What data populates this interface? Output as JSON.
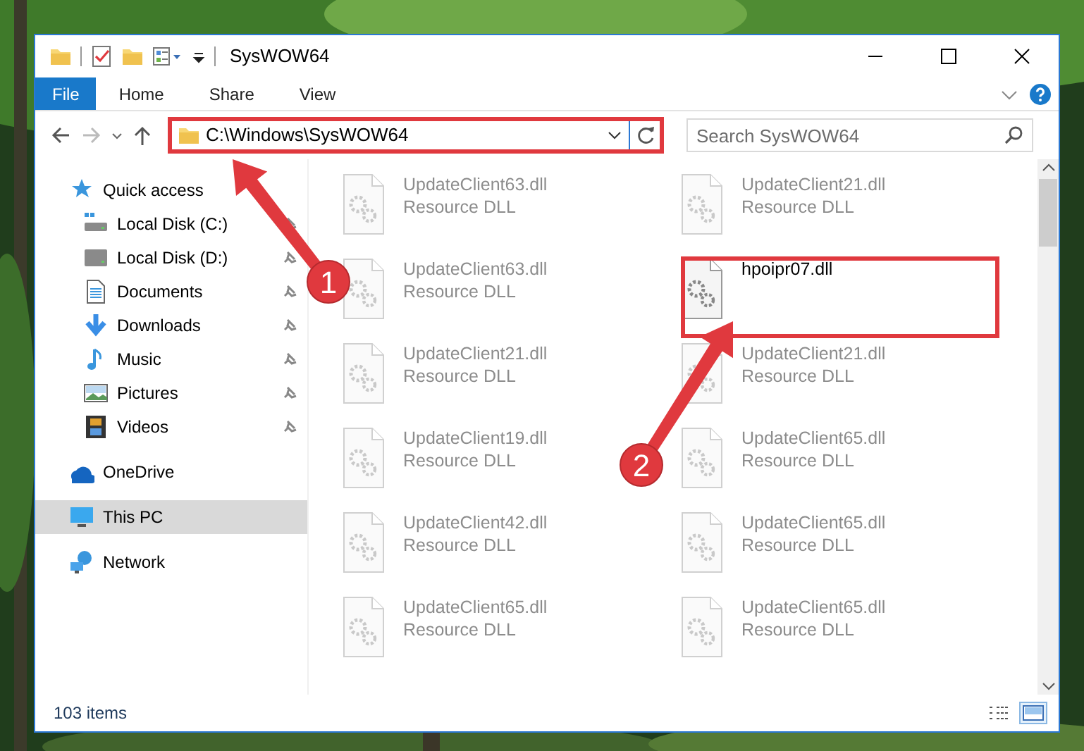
{
  "window": {
    "title": "SysWOW64"
  },
  "ribbon_tabs": [
    {
      "label": "File",
      "kind": "file",
      "selected": false
    },
    {
      "label": "Home",
      "kind": "tab",
      "selected": false
    },
    {
      "label": "Share",
      "kind": "tab",
      "selected": false
    },
    {
      "label": "View",
      "kind": "tab",
      "selected": false
    }
  ],
  "address_bar": {
    "path": "C:\\Windows\\SysWOW64"
  },
  "search": {
    "placeholder": "Search SysWOW64"
  },
  "navigation": [
    {
      "label": "Quick access",
      "kind": "star",
      "selected": false,
      "children": [
        {
          "label": "Local Disk (C:)",
          "kind": "system-drive",
          "pinned": true,
          "selected": false
        },
        {
          "label": "Local Disk (D:)",
          "kind": "drive",
          "pinned": true,
          "selected": false
        },
        {
          "label": "Documents",
          "kind": "documents",
          "pinned": true,
          "selected": false
        },
        {
          "label": "Downloads",
          "kind": "downloads",
          "pinned": true,
          "selected": false
        },
        {
          "label": "Music",
          "kind": "music",
          "pinned": true,
          "selected": false
        },
        {
          "label": "Pictures",
          "kind": "pictures",
          "pinned": true,
          "selected": false
        },
        {
          "label": "Videos",
          "kind": "videos",
          "pinned": true,
          "selected": false
        }
      ]
    },
    {
      "label": "OneDrive",
      "kind": "cloud",
      "selected": false
    },
    {
      "label": "This PC",
      "kind": "computer",
      "selected": true
    },
    {
      "label": "Network",
      "kind": "network",
      "selected": false
    }
  ],
  "files": [
    {
      "name": "UpdateClient63.dll",
      "type": "Resource DLL",
      "blurred": true
    },
    {
      "name": "UpdateClient21.dll",
      "type": "Resource DLL",
      "blurred": true
    },
    {
      "name": "UpdateClient63.dll",
      "type": "Resource DLL",
      "blurred": true
    },
    {
      "name": "hpoipr07.dll",
      "blurred": false
    },
    {
      "name": "UpdateClient21.dll",
      "type": "Resource DLL",
      "blurred": true
    },
    {
      "name": "UpdateClient21.dll",
      "type": "Resource DLL",
      "blurred": true
    },
    {
      "name": "UpdateClient19.dll",
      "type": "Resource DLL",
      "blurred": true
    },
    {
      "name": "UpdateClient65.dll",
      "type": "Resource DLL",
      "blurred": true
    },
    {
      "name": "UpdateClient42.dll",
      "type": "Resource DLL",
      "blurred": true
    },
    {
      "name": "UpdateClient65.dll",
      "type": "Resource DLL",
      "blurred": true
    },
    {
      "name": "UpdateClient65.dll",
      "type": "Resource DLL",
      "blurred": true
    },
    {
      "name": "UpdateClient65.dll",
      "type": "Resource DLL",
      "blurred": true
    }
  ],
  "status_bar": {
    "item_count": "103 items",
    "view_buttons": [
      {
        "kind": "details",
        "selected": false
      },
      {
        "kind": "large-icons",
        "selected": true
      }
    ]
  },
  "annotations": [
    {
      "label": "1"
    },
    {
      "label": "2"
    }
  ]
}
